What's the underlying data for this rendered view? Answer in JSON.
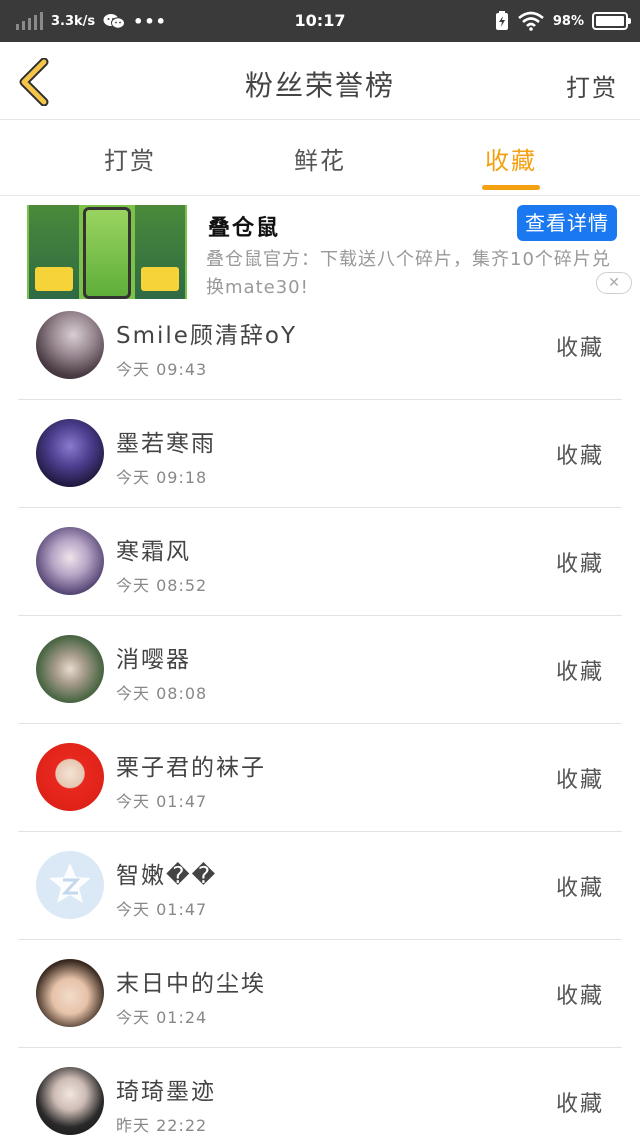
{
  "status_bar": {
    "net_speed": "3.3k/s",
    "dots": "•••",
    "time": "10:17",
    "battery": "98%",
    "icons": [
      "signal-icon",
      "wechat-icon",
      "charging-icon",
      "wifi-icon",
      "battery-icon"
    ]
  },
  "nav": {
    "back_icon": "chevron-left-icon",
    "title": "粉丝荣誉榜",
    "action": "打赏"
  },
  "tabs": [
    {
      "label": "打赏",
      "active": false
    },
    {
      "label": "鲜花",
      "active": false
    },
    {
      "label": "收藏",
      "active": true
    }
  ],
  "ad": {
    "title": "叠仓鼠",
    "button": "查看详情",
    "description": "叠仓鼠官方：下载送八个碎片，集齐10个碎片兑换mate30!",
    "close_icon": "close-icon"
  },
  "list": [
    {
      "name": "Smile顾清辞oY",
      "time": "今天 09:43",
      "action": "收藏"
    },
    {
      "name": "墨若寒雨",
      "time": "今天 09:18",
      "action": "收藏"
    },
    {
      "name": "寒霜风",
      "time": "今天 08:52",
      "action": "收藏"
    },
    {
      "name": "消嘤器",
      "time": "今天 08:08",
      "action": "收藏"
    },
    {
      "name": "栗子君的袜子",
      "time": "今天 01:47",
      "action": "收藏"
    },
    {
      "name": "智嫩��",
      "time": "今天 01:47",
      "action": "收藏"
    },
    {
      "name": "末日中的尘埃",
      "time": "今天 01:24",
      "action": "收藏"
    },
    {
      "name": "琦琦墨迹",
      "time": "昨天 22:22",
      "action": "收藏"
    }
  ],
  "colors": {
    "accent": "#f5a010",
    "status_bar": "#3a3a3a",
    "ad_button": "#1a78f0",
    "divider": "#e3e3e3"
  }
}
